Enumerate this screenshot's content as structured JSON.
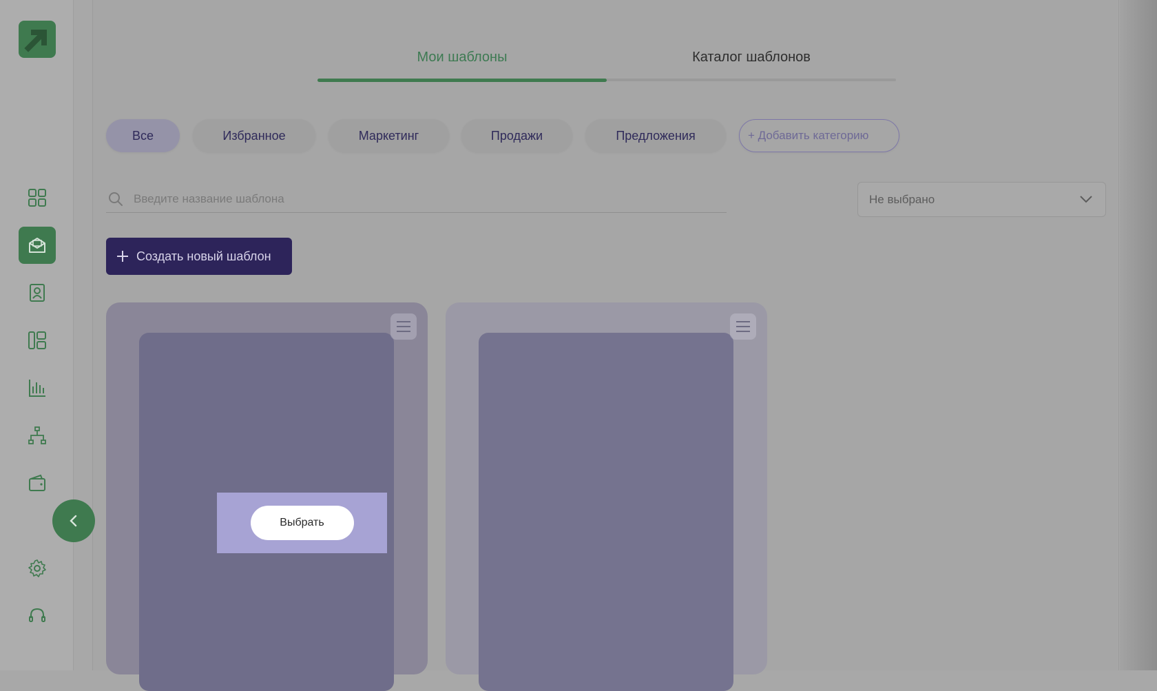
{
  "tabs": [
    {
      "label": "Мои шаблоны",
      "active": true
    },
    {
      "label": "Каталог шаблонов",
      "active": false
    }
  ],
  "categories": [
    {
      "label": "Все",
      "active": true
    },
    {
      "label": "Избранное",
      "active": false
    },
    {
      "label": "Маркетинг",
      "active": false
    },
    {
      "label": "Продажи",
      "active": false
    },
    {
      "label": "Предложения",
      "active": false
    }
  ],
  "add_category_label": "+ Добавить категорию",
  "search": {
    "placeholder": "Введите название шаблона",
    "value": ""
  },
  "filter_select": {
    "value": "Не выбрано"
  },
  "create_button_label": "Создать новый шаблон",
  "cards": [
    {
      "select_label": "Выбрать"
    },
    {}
  ],
  "sidebar": {
    "items": [
      {
        "icon": "dashboard-icon"
      },
      {
        "icon": "mail-templates-icon",
        "active": true
      },
      {
        "icon": "contacts-icon"
      },
      {
        "icon": "layout-icon"
      },
      {
        "icon": "analytics-icon"
      },
      {
        "icon": "hierarchy-icon"
      },
      {
        "icon": "wallet-icon"
      },
      {
        "icon": "settings-icon"
      },
      {
        "icon": "support-icon"
      }
    ]
  },
  "colors": {
    "brand_green": "#3f7a4f",
    "primary_button": "#2d245a",
    "overlay_bg": "#a7a3d4"
  }
}
